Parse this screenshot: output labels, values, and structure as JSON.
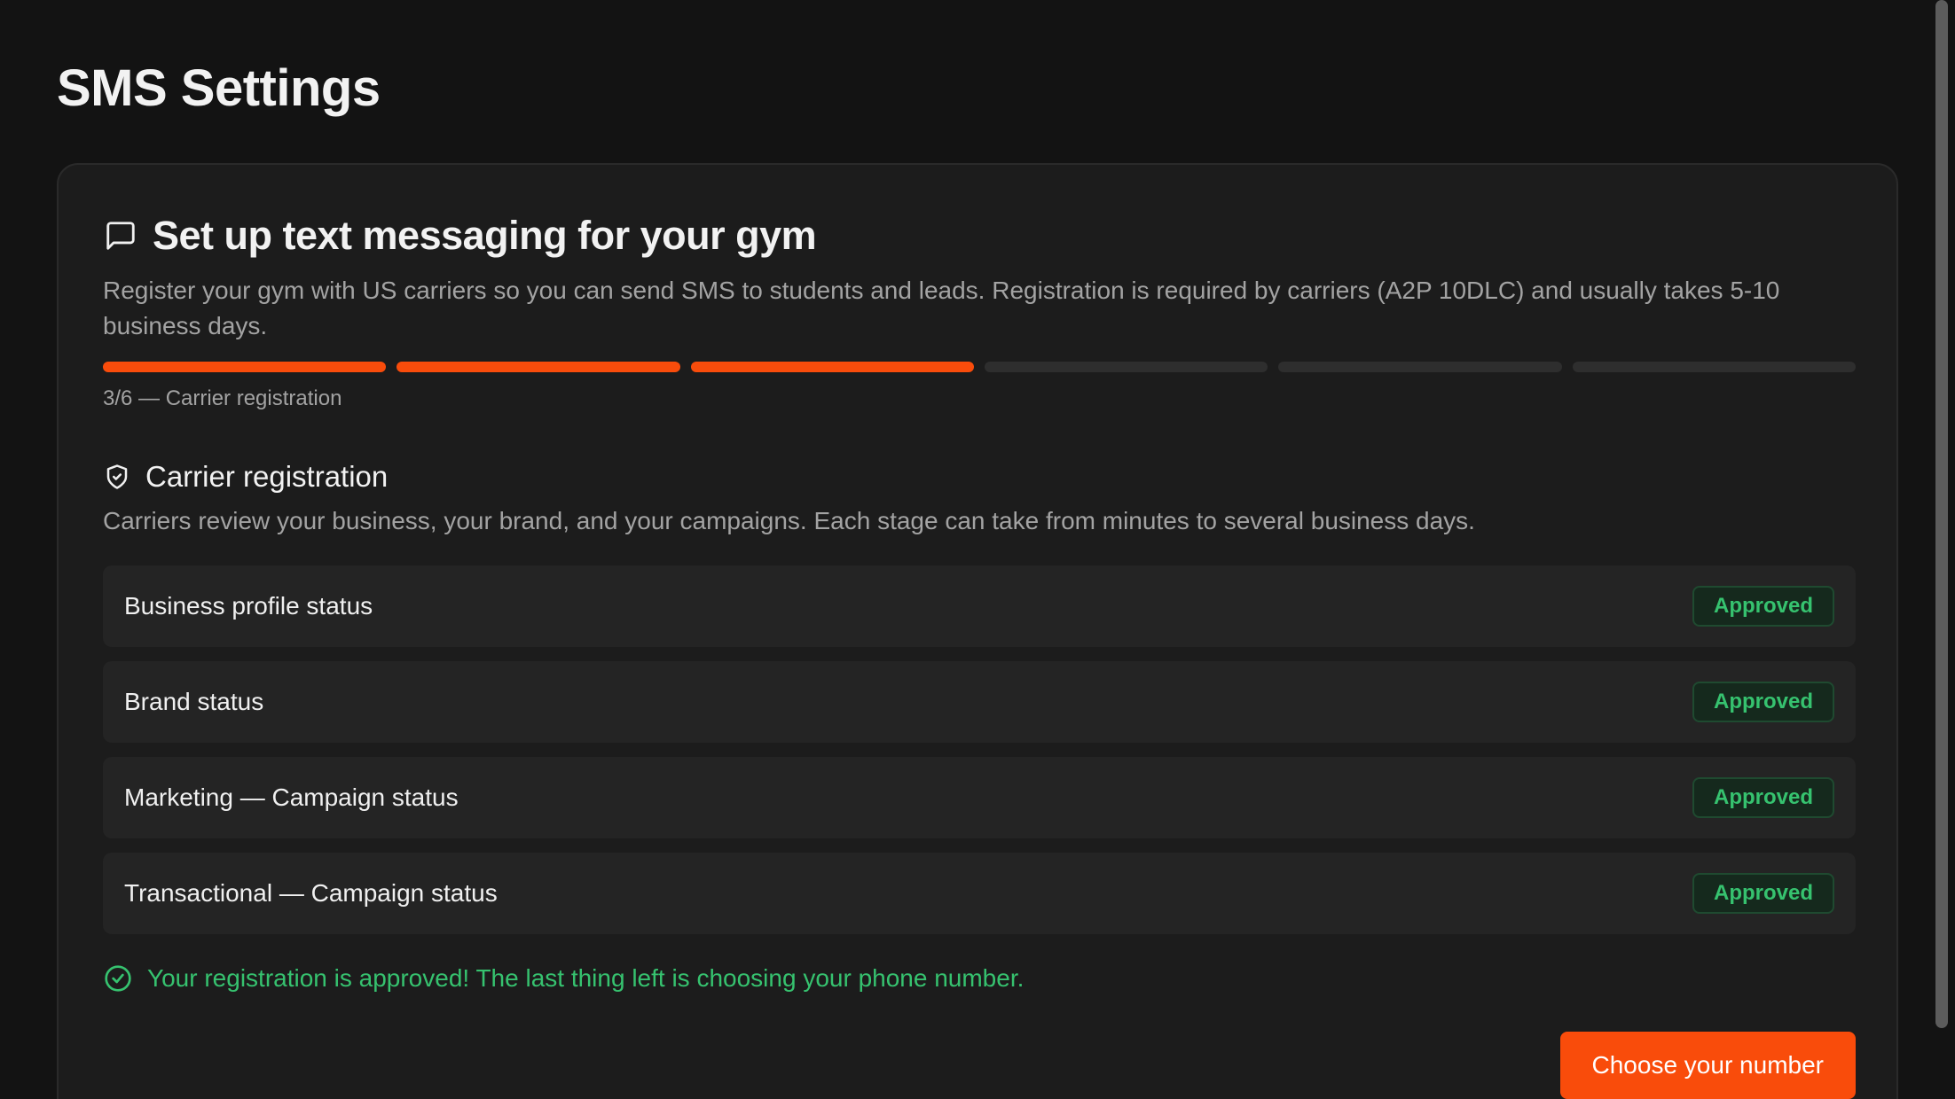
{
  "page": {
    "title": "SMS Settings"
  },
  "setup_card": {
    "icon": "message-square-icon",
    "title": "Set up text messaging for your gym",
    "description": "Register your gym with US carriers so you can send SMS to students and leads. Registration is required by carriers (A2P 10DLC) and usually takes 5-10 business days.",
    "progress": {
      "current_step": 3,
      "total_steps": 6,
      "label": "3/6 — Carrier registration"
    }
  },
  "carrier_registration": {
    "icon": "shield-check-icon",
    "title": "Carrier registration",
    "description": "Carriers review your business, your brand, and your campaigns. Each stage can take from minutes to several business days.",
    "statuses": [
      {
        "label": "Business profile status",
        "status": "Approved"
      },
      {
        "label": "Brand status",
        "status": "Approved"
      },
      {
        "label": "Marketing — Campaign status",
        "status": "Approved"
      },
      {
        "label": "Transactional — Campaign status",
        "status": "Approved"
      }
    ],
    "success": {
      "icon": "check-circle-icon",
      "message": "Your registration is approved! The last thing left is choosing your phone number."
    }
  },
  "actions": {
    "choose_number_label": "Choose your number"
  },
  "colors": {
    "accent": "#f94c0b",
    "success": "#36c26f",
    "background": "#131313",
    "card": "#1c1c1c"
  }
}
